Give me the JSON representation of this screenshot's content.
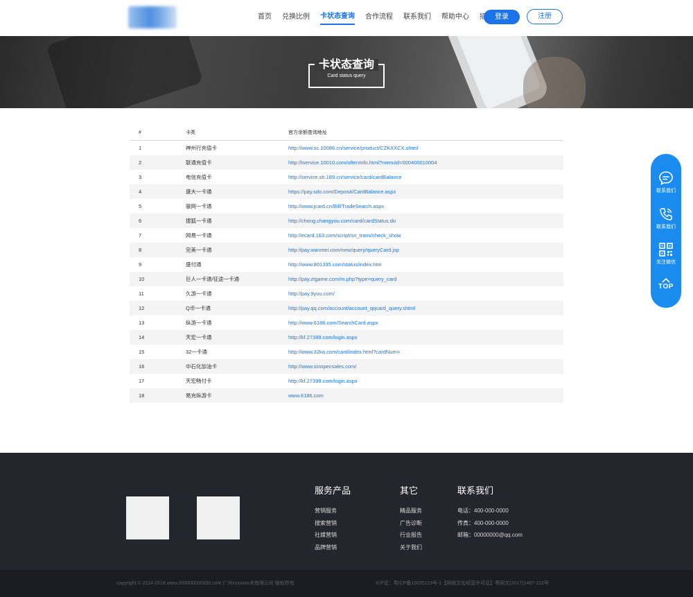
{
  "header": {
    "nav": [
      {
        "label": "首页",
        "active": false
      },
      {
        "label": "兑换比例",
        "active": false
      },
      {
        "label": "卡状态查询",
        "active": true
      },
      {
        "label": "合作流程",
        "active": false
      },
      {
        "label": "联系我们",
        "active": false
      },
      {
        "label": "帮助中心",
        "active": false
      },
      {
        "label": "招商合作",
        "active": false
      }
    ],
    "login_label": "登录",
    "register_label": "注册"
  },
  "banner": {
    "title": "卡状态查询",
    "subtitle": "Card status query"
  },
  "table": {
    "headers": [
      "#",
      "卡类",
      "官方余额查询地址"
    ],
    "rows": [
      {
        "num": "1",
        "name": "神州行充值卡",
        "url": "http://www.sc.10086.cn/service/product/CZKXXCX.shtml"
      },
      {
        "num": "2",
        "name": "联通充值卡",
        "url": "http://iservice.10010.com/oftenInfo.html?menuId=000400010004"
      },
      {
        "num": "3",
        "name": "电信充值卡",
        "url": "http://service.sh.189.cn/service/card/cardBalance"
      },
      {
        "num": "4",
        "name": "盛大一卡通",
        "url": "https://pay.sdo.com/Deposit/CardBalance.aspx"
      },
      {
        "num": "5",
        "name": "骏网一卡通",
        "url": "http://www.jcard.cn/Bill/TradeSearch.aspx"
      },
      {
        "num": "6",
        "name": "搜狐一卡通",
        "url": "http://chong.changyou.com/card/cardStatus.do"
      },
      {
        "num": "7",
        "name": "网易一卡通",
        "url": "http://ecard.163.com/script/sn_trans/check_show"
      },
      {
        "num": "8",
        "name": "完美一卡通",
        "url": "http://pay.wanmei.com/new/query/queryCard.jsp"
      },
      {
        "num": "9",
        "name": "盛付通",
        "url": "http://www.801335.com/status/index.htm"
      },
      {
        "num": "10",
        "name": "巨人一卡通/征途一卡通",
        "url": "http://pay.ztgame.com/m.php?type=query_card"
      },
      {
        "num": "11",
        "name": "久游一卡通",
        "url": "http://pay.9you.com/"
      },
      {
        "num": "12",
        "name": "Q币一卡通",
        "url": "http://pay.qq.com/account/account_qqcard_query.shtml"
      },
      {
        "num": "13",
        "name": "纵游一卡通",
        "url": "http://www.6186.com/SearchCard.aspx"
      },
      {
        "num": "14",
        "name": "天宏一卡通",
        "url": "http://kf.27399.com/login.aspx"
      },
      {
        "num": "15",
        "name": "32一卡通",
        "url": "http://www.32ka.com/card/index.html?cardNum="
      },
      {
        "num": "16",
        "name": "中石化加油卡",
        "url": "http://www.sinopecsales.com/"
      },
      {
        "num": "17",
        "name": "天宏畅付卡",
        "url": "http://kf.27399.com/login.aspx"
      },
      {
        "num": "18",
        "name": "易充纵游卡",
        "url": "www.6186.com"
      }
    ]
  },
  "float_bar": {
    "contact1": "联系我们",
    "contact2": "联系我们",
    "wechat": "关注微信",
    "top": "TOP"
  },
  "footer": {
    "col1": {
      "title": "服务产品",
      "links": [
        "营销服务",
        "搜索营销",
        "社媒营销",
        "品牌营销"
      ]
    },
    "col2": {
      "title": "其它",
      "links": [
        "精品服务",
        "广告诊断",
        "行业报告",
        "关于我们"
      ]
    },
    "col3": {
      "title": "联系我们",
      "lines": [
        "电话：400-000-0000",
        "传真：400-000-0000",
        "邮箱：00000000@qq.com"
      ]
    },
    "copyright": "copyright © 2014-2018 www.000000000000.com 广州xxxxxxx术有限公司 版权所有",
    "icp": "ICP证：粤ICP备15035119号-1【网络文化经营许可证】粤网文(2017)1467-102号"
  },
  "colors": {
    "accent": "#1a73e8",
    "float_bar": "#1a8cf0",
    "footer_bg": "#23262d"
  }
}
